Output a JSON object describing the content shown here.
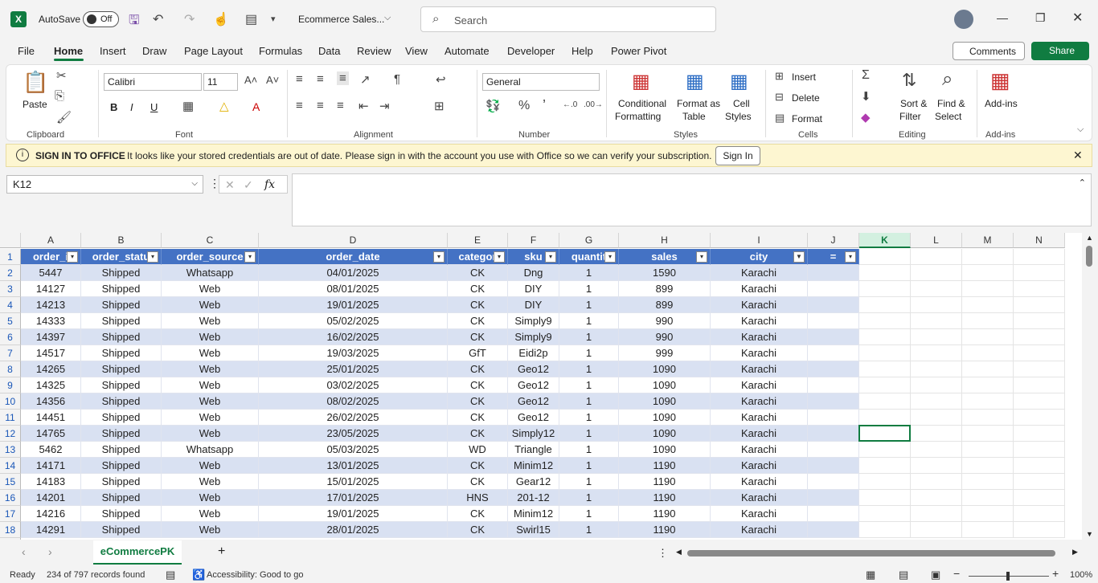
{
  "titlebar": {
    "autosave_label": "AutoSave",
    "autosave_state": "Off",
    "doc_title": "Ecommerce Sales...",
    "search_placeholder": "Search"
  },
  "menu": [
    "File",
    "Home",
    "Insert",
    "Draw",
    "Page Layout",
    "Formulas",
    "Data",
    "Review",
    "View",
    "Automate",
    "Developer",
    "Help",
    "Power Pivot"
  ],
  "comments_label": "Comments",
  "share_label": "Share",
  "ribbon": {
    "clipboard": {
      "paste": "Paste",
      "label": "Clipboard"
    },
    "font": {
      "name": "Calibri",
      "size": "11",
      "label": "Font"
    },
    "alignment": {
      "label": "Alignment"
    },
    "number": {
      "format": "General",
      "label": "Number"
    },
    "styles": {
      "conditional_1": "Conditional",
      "conditional_2": "Formatting",
      "format_as_1": "Format as",
      "format_as_2": "Table",
      "cell_styles_1": "Cell",
      "cell_styles_2": "Styles",
      "label": "Styles"
    },
    "cells": {
      "insert": "Insert",
      "delete": "Delete",
      "format": "Format",
      "label": "Cells"
    },
    "editing": {
      "sort_1": "Sort &",
      "sort_2": "Filter",
      "find_1": "Find &",
      "find_2": "Select",
      "label": "Editing"
    },
    "addins": {
      "addins": "Add-ins",
      "label": "Add-ins"
    }
  },
  "notification": {
    "title": "SIGN IN TO OFFICE",
    "message": "It looks like your stored credentials are out of date. Please sign in with the account you use with Office so we can verify your subscription.",
    "button": "Sign In"
  },
  "namebox": "K12",
  "columns": [
    "A",
    "B",
    "C",
    "D",
    "E",
    "F",
    "G",
    "H",
    "I",
    "J",
    "K",
    "L",
    "M",
    "N"
  ],
  "selected_column": "K",
  "table_headers": [
    "order_i",
    "order_statu",
    "order_source",
    "order_date",
    "categor",
    "sku",
    "quantit",
    "sales",
    "city",
    "="
  ],
  "rows": [
    {
      "n": "2",
      "cells": [
        "5447",
        "Shipped",
        "Whatsapp",
        "04/01/2025",
        "CK",
        "Dng",
        "1",
        "1590",
        "Karachi",
        ""
      ]
    },
    {
      "n": "3",
      "cells": [
        "14127",
        "Shipped",
        "Web",
        "08/01/2025",
        "CK",
        "DIY",
        "1",
        "899",
        "Karachi",
        ""
      ]
    },
    {
      "n": "4",
      "cells": [
        "14213",
        "Shipped",
        "Web",
        "19/01/2025",
        "CK",
        "DIY",
        "1",
        "899",
        "Karachi",
        ""
      ]
    },
    {
      "n": "5",
      "cells": [
        "14333",
        "Shipped",
        "Web",
        "05/02/2025",
        "CK",
        "Simply9",
        "1",
        "990",
        "Karachi",
        ""
      ]
    },
    {
      "n": "6",
      "cells": [
        "14397",
        "Shipped",
        "Web",
        "16/02/2025",
        "CK",
        "Simply9",
        "1",
        "990",
        "Karachi",
        ""
      ]
    },
    {
      "n": "7",
      "cells": [
        "14517",
        "Shipped",
        "Web",
        "19/03/2025",
        "GfT",
        "Eidi2p",
        "1",
        "999",
        "Karachi",
        ""
      ]
    },
    {
      "n": "8",
      "cells": [
        "14265",
        "Shipped",
        "Web",
        "25/01/2025",
        "CK",
        "Geo12",
        "1",
        "1090",
        "Karachi",
        ""
      ]
    },
    {
      "n": "9",
      "cells": [
        "14325",
        "Shipped",
        "Web",
        "03/02/2025",
        "CK",
        "Geo12",
        "1",
        "1090",
        "Karachi",
        ""
      ]
    },
    {
      "n": "10",
      "cells": [
        "14356",
        "Shipped",
        "Web",
        "08/02/2025",
        "CK",
        "Geo12",
        "1",
        "1090",
        "Karachi",
        ""
      ]
    },
    {
      "n": "11",
      "cells": [
        "14451",
        "Shipped",
        "Web",
        "26/02/2025",
        "CK",
        "Geo12",
        "1",
        "1090",
        "Karachi",
        ""
      ]
    },
    {
      "n": "12",
      "cells": [
        "14765",
        "Shipped",
        "Web",
        "23/05/2025",
        "CK",
        "Simply12",
        "1",
        "1090",
        "Karachi",
        ""
      ]
    },
    {
      "n": "13",
      "cells": [
        "5462",
        "Shipped",
        "Whatsapp",
        "05/03/2025",
        "WD",
        "Triangle",
        "1",
        "1090",
        "Karachi",
        ""
      ]
    },
    {
      "n": "14",
      "cells": [
        "14171",
        "Shipped",
        "Web",
        "13/01/2025",
        "CK",
        "Minim12",
        "1",
        "1190",
        "Karachi",
        ""
      ]
    },
    {
      "n": "15",
      "cells": [
        "14183",
        "Shipped",
        "Web",
        "15/01/2025",
        "CK",
        "Gear12",
        "1",
        "1190",
        "Karachi",
        ""
      ]
    },
    {
      "n": "16",
      "cells": [
        "14201",
        "Shipped",
        "Web",
        "17/01/2025",
        "HNS",
        "201-12",
        "1",
        "1190",
        "Karachi",
        ""
      ]
    },
    {
      "n": "17",
      "cells": [
        "14216",
        "Shipped",
        "Web",
        "19/01/2025",
        "CK",
        "Minim12",
        "1",
        "1190",
        "Karachi",
        ""
      ]
    },
    {
      "n": "18",
      "cells": [
        "14291",
        "Shipped",
        "Web",
        "28/01/2025",
        "CK",
        "Swirl15",
        "1",
        "1190",
        "Karachi",
        ""
      ]
    }
  ],
  "sheet_tab": "eCommercePK",
  "status": {
    "ready": "Ready",
    "records": "234 of 797 records found",
    "accessibility": "Accessibility: Good to go",
    "zoom": "100%"
  },
  "colors": {
    "accent": "#107c41",
    "table_header": "#4472c4",
    "band": "#d9e1f2"
  }
}
